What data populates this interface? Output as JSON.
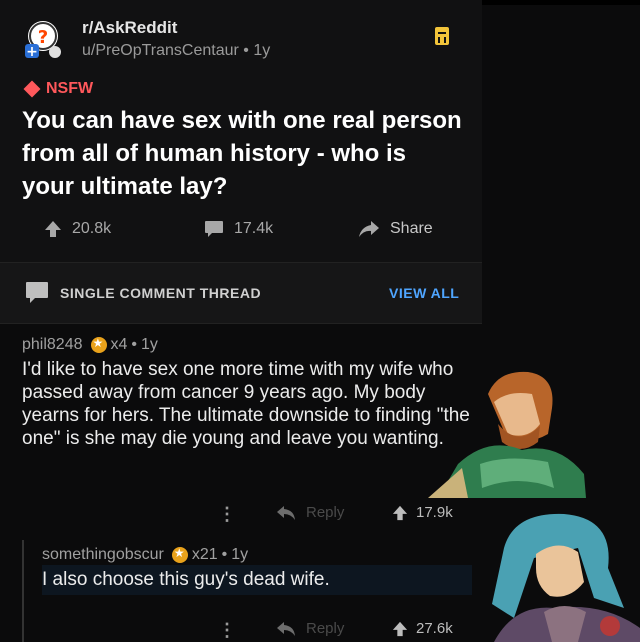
{
  "post": {
    "subreddit": "r/AskReddit",
    "author": "u/PreOpTransCentaur",
    "age": "1y",
    "nsfw_label": "NSFW",
    "title": "You can have sex with one real person from all of human history - who is your ultimate lay?",
    "upvotes": "20.8k",
    "comments": "17.4k",
    "share_label": "Share"
  },
  "thread_bar": {
    "label": "SINGLE COMMENT THREAD",
    "view_all": "VIEW ALL"
  },
  "comment1": {
    "author": "phil8248",
    "awards": "x4",
    "age": "1y",
    "body": "I'd like to have sex one more time with my wife who passed away from cancer 9 years ago. My body yearns for hers. The ultimate downside to finding \"the one\" is she may die young and leave you wanting.",
    "reply_label": "Reply",
    "score": "17.9k"
  },
  "comment2": {
    "author": "somethingobscur",
    "awards": "x21",
    "age": "1y",
    "body": "I also choose this guy's dead wife.",
    "reply_label": "Reply",
    "score": "27.6k"
  },
  "colors": {
    "nsfw": "#ff585b",
    "link": "#4fa5ff",
    "award": "#e9a21b",
    "save": "#f2c43a"
  }
}
